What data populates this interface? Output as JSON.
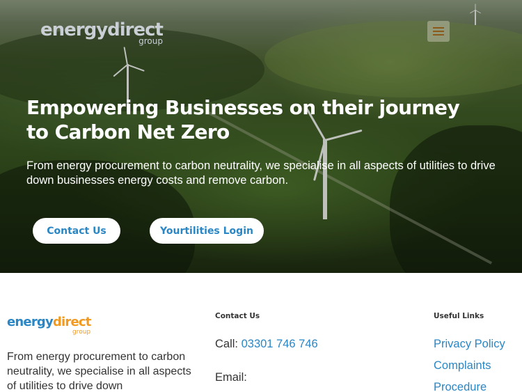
{
  "header": {
    "logo_text": "energydirect",
    "logo_sub": "group",
    "menu_icon": "hamburger-menu-icon"
  },
  "hero": {
    "title": "Empowering Businesses on their journey to Carbon Net Zero",
    "subtitle": "From energy procurement to carbon neutrality, we specialise in all aspects of utilities to drive down businesses energy costs and remove carbon.",
    "buttons": {
      "contact": "Contact Us",
      "login": "Yourtilities Login"
    }
  },
  "footer": {
    "logo_energy": "energy",
    "logo_direct": "direct",
    "logo_sub": "group",
    "description": "From energy procurement to carbon neutrality, we specialise in all aspects of utilities to drive down",
    "contact": {
      "heading": "Contact Us",
      "call_label": "Call: ",
      "phone": "03301 746 746",
      "email_label": "Email:"
    },
    "links": {
      "heading": "Useful Links",
      "items": [
        "Privacy Policy",
        "Complaints",
        "Procedure"
      ]
    }
  },
  "colors": {
    "brand_blue": "#2a86c4",
    "brand_orange": "#f29a1f",
    "text": "#333333"
  }
}
